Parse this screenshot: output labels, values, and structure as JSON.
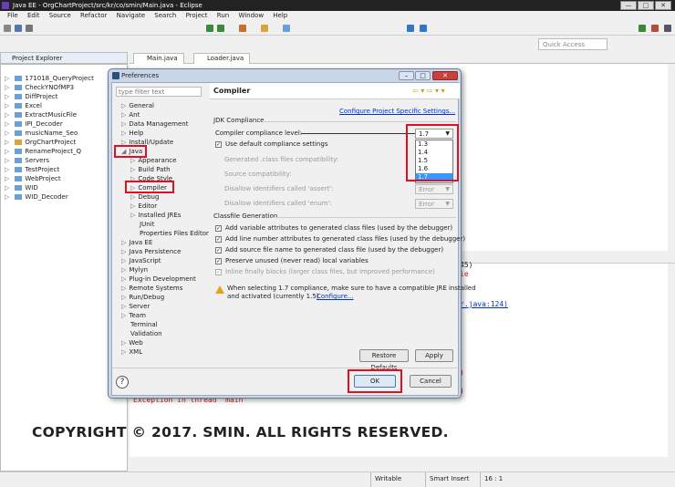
{
  "window": {
    "title": "Java EE - OrgChartProject/src/kr/co/smin/Main.java - Eclipse",
    "minimize": "—",
    "maximize": "□",
    "close": "✕"
  },
  "menu": [
    "File",
    "Edit",
    "Source",
    "Refactor",
    "Navigate",
    "Search",
    "Project",
    "Run",
    "Window",
    "Help"
  ],
  "quick_access_placeholder": "Quick Access",
  "project_explorer": {
    "title": "Project Explorer",
    "items": [
      "171018_QueryProject",
      "CheckYNOfMP3",
      "DiffProject",
      "Excel",
      "ExtractMusicFile",
      "IPI_Decoder",
      "musicName_Seo",
      "OrgChartProject",
      "RenameProject_Q",
      "Servers",
      "TestProject",
      "WebProject",
      "WID",
      "WID_Decoder"
    ]
  },
  "editor_tabs": [
    "Main.java",
    "Loader.java"
  ],
  "console": {
    "line1": "45)",
    "line2": "le",
    "link": "r.java:124)",
    "exception": "Exception in thread \"main\"",
    "tail1": ")",
    "tail2": ")"
  },
  "dialog": {
    "title": "Preferences",
    "filter_placeholder": "type filter text",
    "nav": {
      "general": "General",
      "ant": "Ant",
      "data_management": "Data Management",
      "help": "Help",
      "install_update": "Install/Update",
      "java": "Java",
      "appearance": "Appearance",
      "build_path": "Build Path",
      "code_style": "Code Style",
      "compiler": "Compiler",
      "debug": "Debug",
      "editor": "Editor",
      "installed_jres": "Installed JREs",
      "junit": "JUnit",
      "properties_files_editor": "Properties Files Editor",
      "java_ee": "Java EE",
      "java_persistence": "Java Persistence",
      "javascript": "JavaScript",
      "mylyn": "Mylyn",
      "plugin_development": "Plug-in Development",
      "remote_systems": "Remote Systems",
      "run_debug": "Run/Debug",
      "server": "Server",
      "team": "Team",
      "terminal": "Terminal",
      "validation": "Validation",
      "web": "Web",
      "xml": "XML"
    },
    "panel": {
      "heading": "Compiler",
      "configure_link": "Configure Project Specific Settings...",
      "jdk_group": "JDK Compliance",
      "compliance_label": "Compiler compliance level:",
      "compliance_value": "1.7",
      "use_default": "Use default compliance settings",
      "gen_class_compat": "Generated .class files compatibility:",
      "source_compat": "Source compatibility:",
      "disallow_assert": "Disallow identifiers called 'assert':",
      "disallow_assert_value": "Error",
      "disallow_enum": "Disallow identifiers called 'enum':",
      "disallow_enum_value": "Error",
      "classfile_group": "Classfile Generation",
      "opt_var_attr": "Add variable attributes to generated class files (used by the debugger)",
      "opt_line_attr": "Add line number attributes to generated class files (used by the debugger)",
      "opt_src_name": "Add source file name to generated class file (used by the debugger)",
      "opt_preserve": "Preserve unused (never read) local variables",
      "opt_inline": "Inline finally blocks (larger class files, but improved performance)",
      "warning_line1": "When selecting 1.7 compliance, make sure to have a compatible JRE installed",
      "warning_line2": "and activated (currently 1.5).",
      "warning_link": "Configure...",
      "dropdown_options": [
        "1.3",
        "1.4",
        "1.5",
        "1.6",
        "1.7"
      ]
    },
    "buttons": {
      "restore": "Restore Defaults",
      "apply": "Apply",
      "ok": "OK",
      "cancel": "Cancel",
      "help": "?"
    }
  },
  "copyright": "COPYRIGHT © 2017. SMIN. ALL RIGHTS RESERVED.",
  "status": {
    "writable": "Writable",
    "insert": "Smart Insert",
    "position": "16 : 1"
  },
  "colors": {
    "highlight": "#e01020",
    "link": "#0033cc",
    "selection": "#3399ff"
  }
}
